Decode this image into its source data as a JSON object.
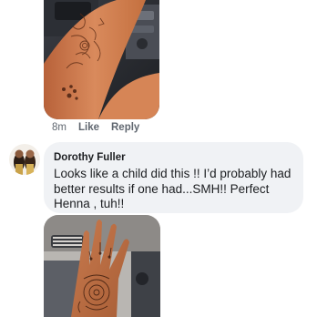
{
  "comment_1": {
    "meta": {
      "time": "8m",
      "like_label": "Like",
      "reply_label": "Reply"
    }
  },
  "comment_2": {
    "author": "Dorothy Fuller",
    "text": "Looks like a child did this !! I’d probably had better results if one had...SMH!! Perfect Henna , tuh!!"
  }
}
